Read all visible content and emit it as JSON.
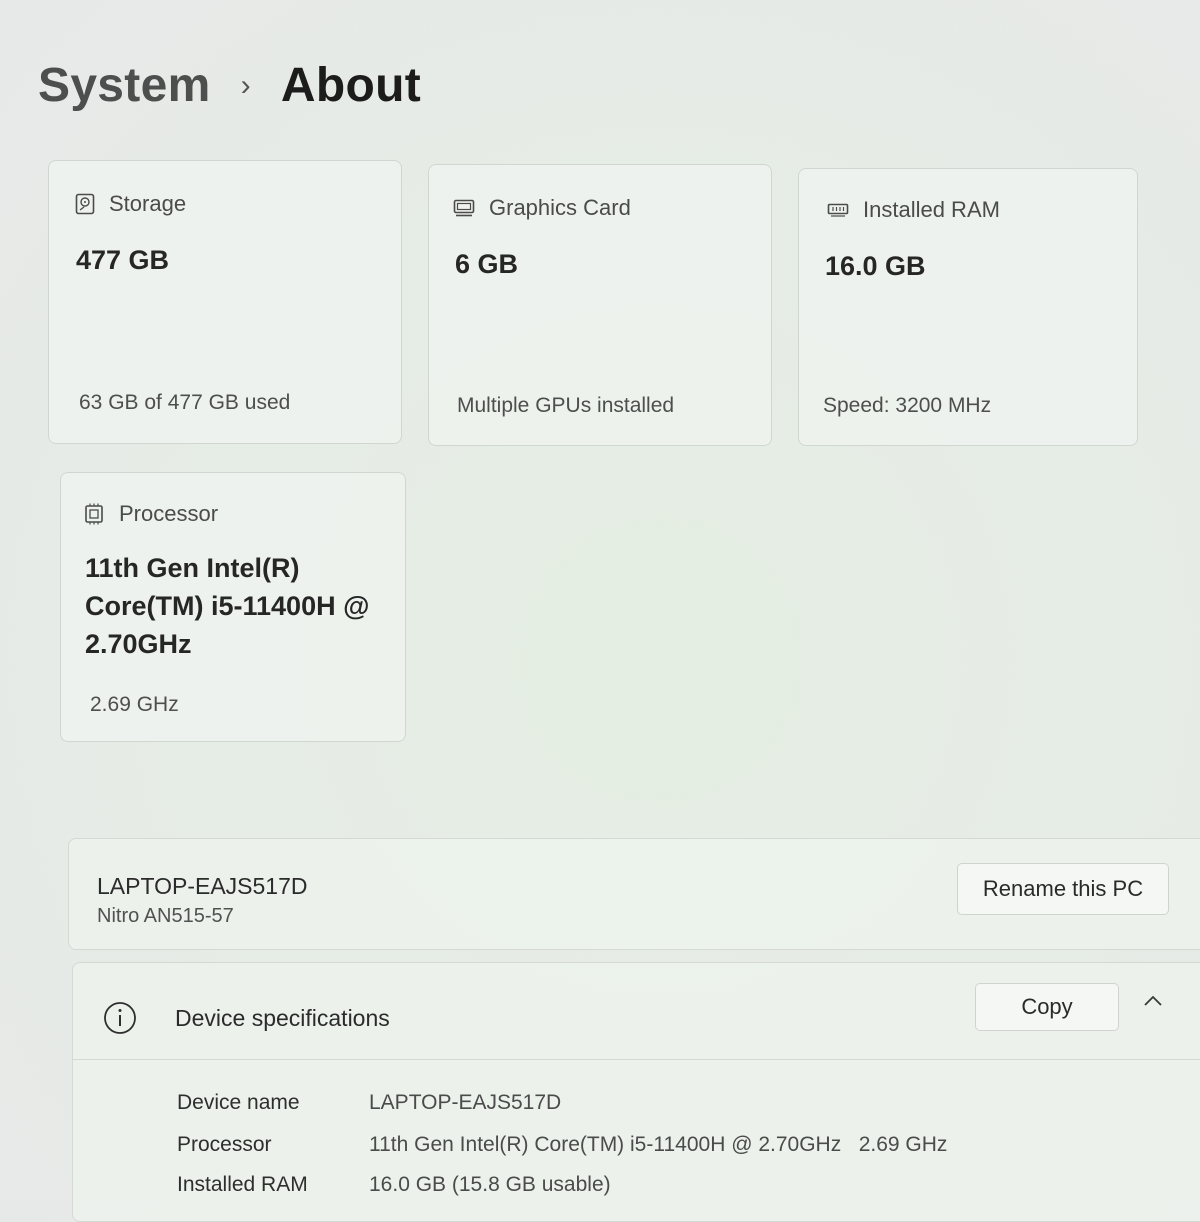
{
  "breadcrumb": {
    "root": "System",
    "separator": "›",
    "current": "About"
  },
  "cards": {
    "storage": {
      "icon": "storage-icon",
      "label": "Storage",
      "value": "477 GB",
      "sub": "63 GB of 477 GB used"
    },
    "graphics": {
      "icon": "graphics-card-icon",
      "label": "Graphics Card",
      "value": "6 GB",
      "sub": "Multiple GPUs installed"
    },
    "ram": {
      "icon": "ram-icon",
      "label": "Installed RAM",
      "value": "16.0 GB",
      "sub": "Speed: 3200 MHz"
    },
    "processor": {
      "icon": "processor-icon",
      "label": "Processor",
      "value_lines": [
        "11th Gen Intel(R)",
        "Core(TM) i5-11400H @",
        "2.70GHz"
      ],
      "sub": "2.69 GHz"
    }
  },
  "pc": {
    "name": "LAPTOP-EAJS517D",
    "model": "Nitro AN515-57",
    "rename_label": "Rename this PC"
  },
  "specs": {
    "icon": "info-icon",
    "title": "Device specifications",
    "copy_label": "Copy",
    "rows": [
      {
        "key": "Device name",
        "value": "LAPTOP-EAJS517D"
      },
      {
        "key": "Processor",
        "value": "11th Gen Intel(R) Core(TM) i5-11400H @ 2.70GHz   2.69 GHz"
      },
      {
        "key": "Installed RAM",
        "value": "16.0 GB (15.8 GB usable)"
      }
    ]
  }
}
